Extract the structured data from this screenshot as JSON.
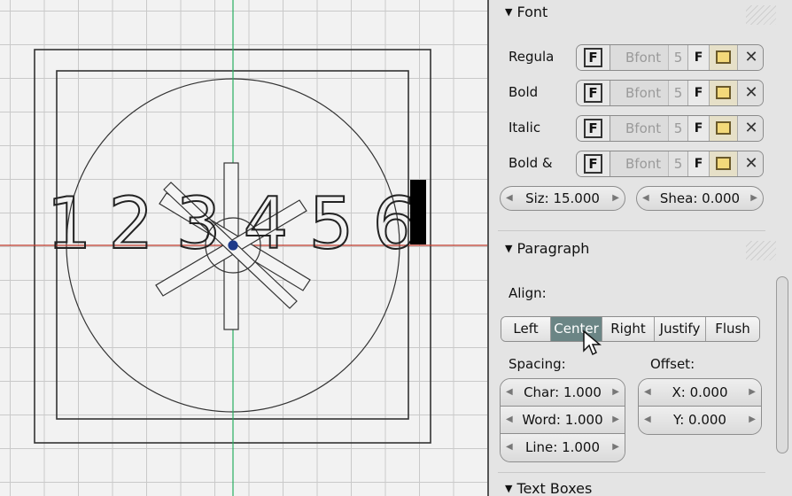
{
  "viewport": {
    "text_object_chars": [
      "1",
      "2",
      "3",
      "4",
      "5",
      "6"
    ],
    "colors": {
      "x_axis": "#c0392b",
      "y_axis": "#27ae60",
      "grid": "#c9c9c9",
      "outline": "#333333"
    }
  },
  "panel": {
    "font_section": {
      "title": "Font",
      "rows": [
        {
          "label": "Regula",
          "font_name": "Bfont",
          "users": "5",
          "fake_user": "F"
        },
        {
          "label": "Bold",
          "font_name": "Bfont",
          "users": "5",
          "fake_user": "F"
        },
        {
          "label": "Italic",
          "font_name": "Bfont",
          "users": "5",
          "fake_user": "F"
        },
        {
          "label": "Bold &",
          "font_name": "Bfont",
          "users": "5",
          "fake_user": "F"
        }
      ],
      "size_field": "Siz: 15.000",
      "shear_field": "Shea: 0.000"
    },
    "paragraph_section": {
      "title": "Paragraph",
      "align_label": "Align:",
      "align_buttons": [
        "Left",
        "Center",
        "Right",
        "Justify",
        "Flush"
      ],
      "align_selected": "Center",
      "spacing_label": "Spacing:",
      "offset_label": "Offset:",
      "char_field": "Char: 1.000",
      "word_field": "Word: 1.000",
      "line_field": "Line: 1.000",
      "offset_x_field": "X: 0.000",
      "offset_y_field": "Y: 0.000"
    },
    "textboxes_section": {
      "title": "Text Boxes"
    }
  }
}
